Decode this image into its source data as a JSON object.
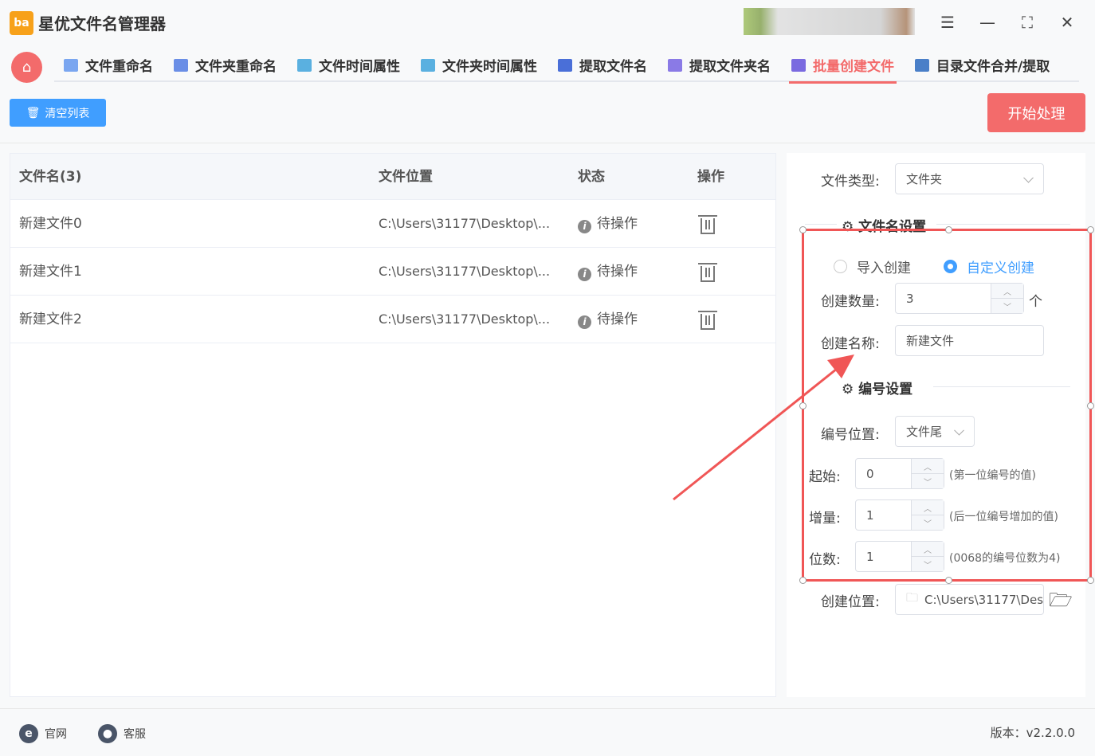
{
  "app": {
    "title": "星优文件名管理器",
    "logo_text": "ba"
  },
  "window_controls": [
    "settings-icon",
    "minimize-icon",
    "maximize-icon",
    "close-icon"
  ],
  "tabs": [
    {
      "label": "文件重命名",
      "active": false
    },
    {
      "label": "文件夹重命名",
      "active": false
    },
    {
      "label": "文件时间属性",
      "active": false
    },
    {
      "label": "文件夹时间属性",
      "active": false
    },
    {
      "label": "提取文件名",
      "active": false
    },
    {
      "label": "提取文件夹名",
      "active": false
    },
    {
      "label": "批量创建文件",
      "active": true
    },
    {
      "label": "目录文件合并/提取",
      "active": false
    }
  ],
  "toolbar": {
    "clear_label": "清空列表",
    "start_label": "开始处理"
  },
  "table": {
    "headers": [
      "文件名(3)",
      "文件位置",
      "状态",
      "操作"
    ],
    "rows": [
      {
        "name": "新建文件0",
        "location": "C:\\Users\\31177\\Desktop\\...",
        "status": "待操作"
      },
      {
        "name": "新建文件1",
        "location": "C:\\Users\\31177\\Desktop\\...",
        "status": "待操作"
      },
      {
        "name": "新建文件2",
        "location": "C:\\Users\\31177\\Desktop\\...",
        "status": "待操作"
      }
    ]
  },
  "settings": {
    "file_type_label": "文件类型:",
    "file_type_value": "文件夹",
    "filename_section": "文件名设置",
    "radio_import": "导入创建",
    "radio_custom": "自定义创建",
    "radio_selected": "自定义创建",
    "count_label": "创建数量:",
    "count_value": "3",
    "count_unit": "个",
    "name_label": "创建名称:",
    "name_value": "新建文件",
    "number_section": "编号设置",
    "position_label": "编号位置:",
    "position_value": "文件尾",
    "start_label": "起始:",
    "start_value": "0",
    "start_hint": "(第一位编号的值)",
    "step_label": "增量:",
    "step_value": "1",
    "step_hint": "(后一位编号增加的值)",
    "digits_label": "位数:",
    "digits_value": "1",
    "digits_hint": "(0068的编号位数为4)",
    "location_label": "创建位置:",
    "location_value": "C:\\Users\\31177\\Des"
  },
  "footer": {
    "website": "官网",
    "support": "客服",
    "version": "版本：v2.2.0.0"
  },
  "colors": {
    "accent": "#f36b6b",
    "primary": "#409eff",
    "annotation": "#f05656"
  }
}
